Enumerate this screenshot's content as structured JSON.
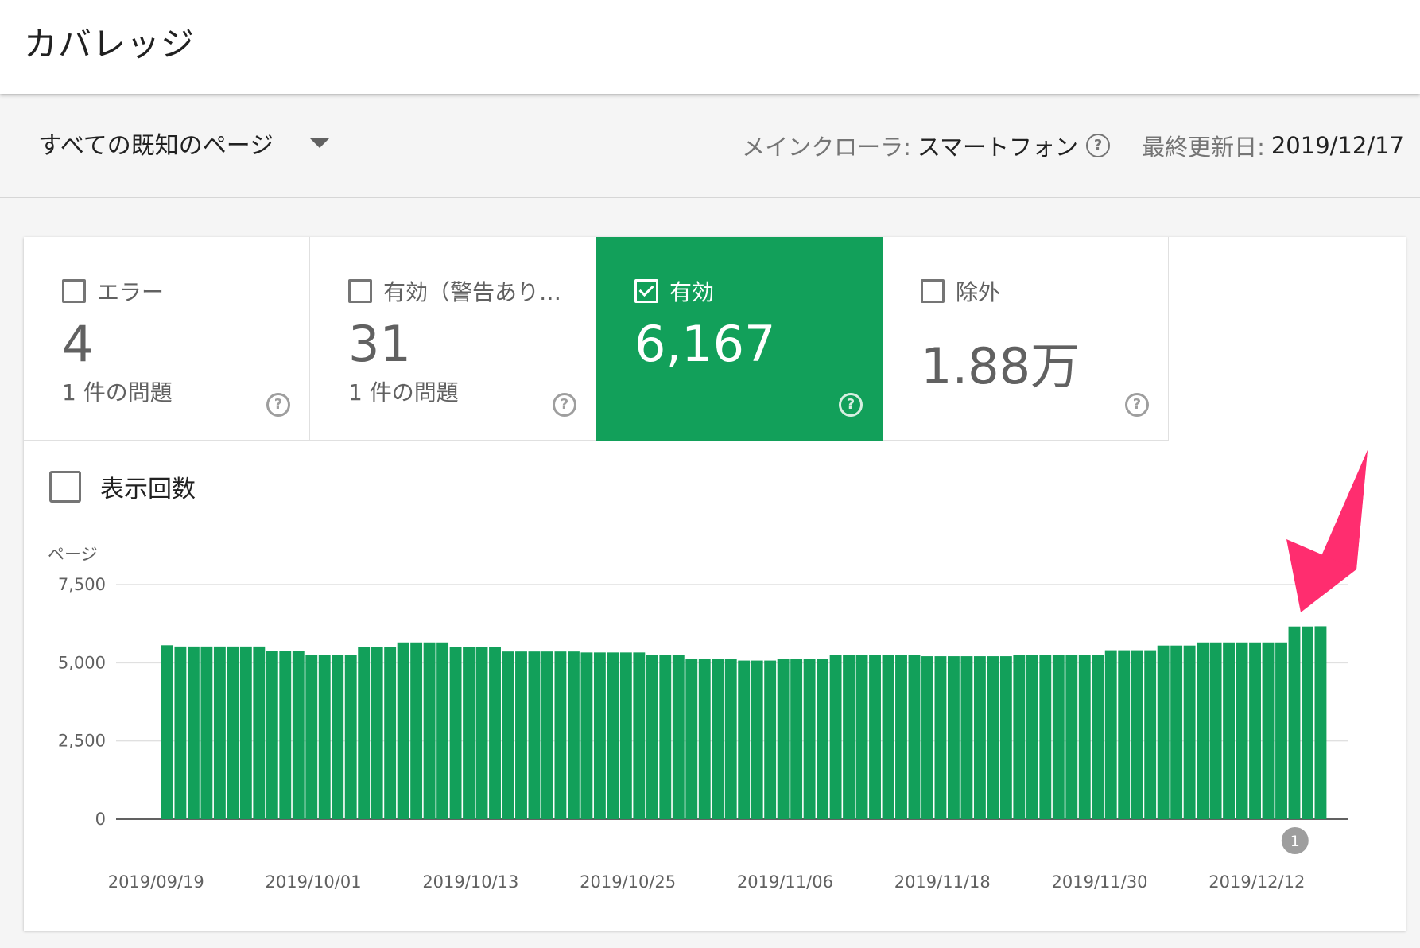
{
  "header": {
    "title": "カバレッジ"
  },
  "filter": {
    "page_scope": "すべての既知のページ",
    "crawler_key": "メインクローラ:",
    "crawler_value": "スマートフォン",
    "updated_key": "最終更新日:",
    "updated_value": "2019/12/17"
  },
  "tiles": [
    {
      "label": "エラー",
      "value": "4",
      "sub": "1 件の問題",
      "checked": false
    },
    {
      "label": "有効（警告あり…",
      "value": "31",
      "sub": "1 件の問題",
      "checked": false
    },
    {
      "label": "有効",
      "value": "6,167",
      "sub": "",
      "checked": true
    },
    {
      "label": "除外",
      "value": "1.88万",
      "sub": "",
      "checked": false
    }
  ],
  "impressions_toggle": {
    "label": "表示回数",
    "checked": false
  },
  "colors": {
    "accent": "#12a05a",
    "arrow": "#ff2d6f"
  },
  "chart_data": {
    "type": "bar",
    "ylabel": "ページ",
    "ylim": [
      0,
      7500
    ],
    "yticks": [
      "7,500",
      "5,000",
      "2,500",
      "0"
    ],
    "ytick_values": [
      7500,
      5000,
      2500,
      0
    ],
    "xtick_labels": [
      "2019/09/19",
      "2019/10/01",
      "2019/10/13",
      "2019/10/25",
      "2019/11/06",
      "2019/11/18",
      "2019/11/30",
      "2019/12/12"
    ],
    "annotation": {
      "label": "1",
      "date": "2019/12/14"
    },
    "series": [
      {
        "values": [
          5560,
          5520,
          5520,
          5520,
          5520,
          5520,
          5520,
          5520,
          5380,
          5380,
          5380,
          5260,
          5260,
          5260,
          5260,
          5500,
          5500,
          5500,
          5650,
          5650,
          5650,
          5650,
          5500,
          5500,
          5500,
          5500,
          5360,
          5360,
          5360,
          5360,
          5360,
          5360,
          5330,
          5330,
          5330,
          5330,
          5330,
          5240,
          5240,
          5240,
          5130,
          5130,
          5130,
          5130,
          5070,
          5070,
          5070,
          5110,
          5110,
          5110,
          5110,
          5260,
          5260,
          5260,
          5260,
          5260,
          5260,
          5260,
          5210,
          5210,
          5210,
          5210,
          5210,
          5210,
          5210,
          5260,
          5260,
          5260,
          5260,
          5260,
          5260,
          5260,
          5400,
          5400,
          5400,
          5400,
          5550,
          5550,
          5550,
          5650,
          5650,
          5650,
          5650,
          5650,
          5650,
          5650,
          6160,
          6160,
          6167
        ]
      }
    ]
  }
}
